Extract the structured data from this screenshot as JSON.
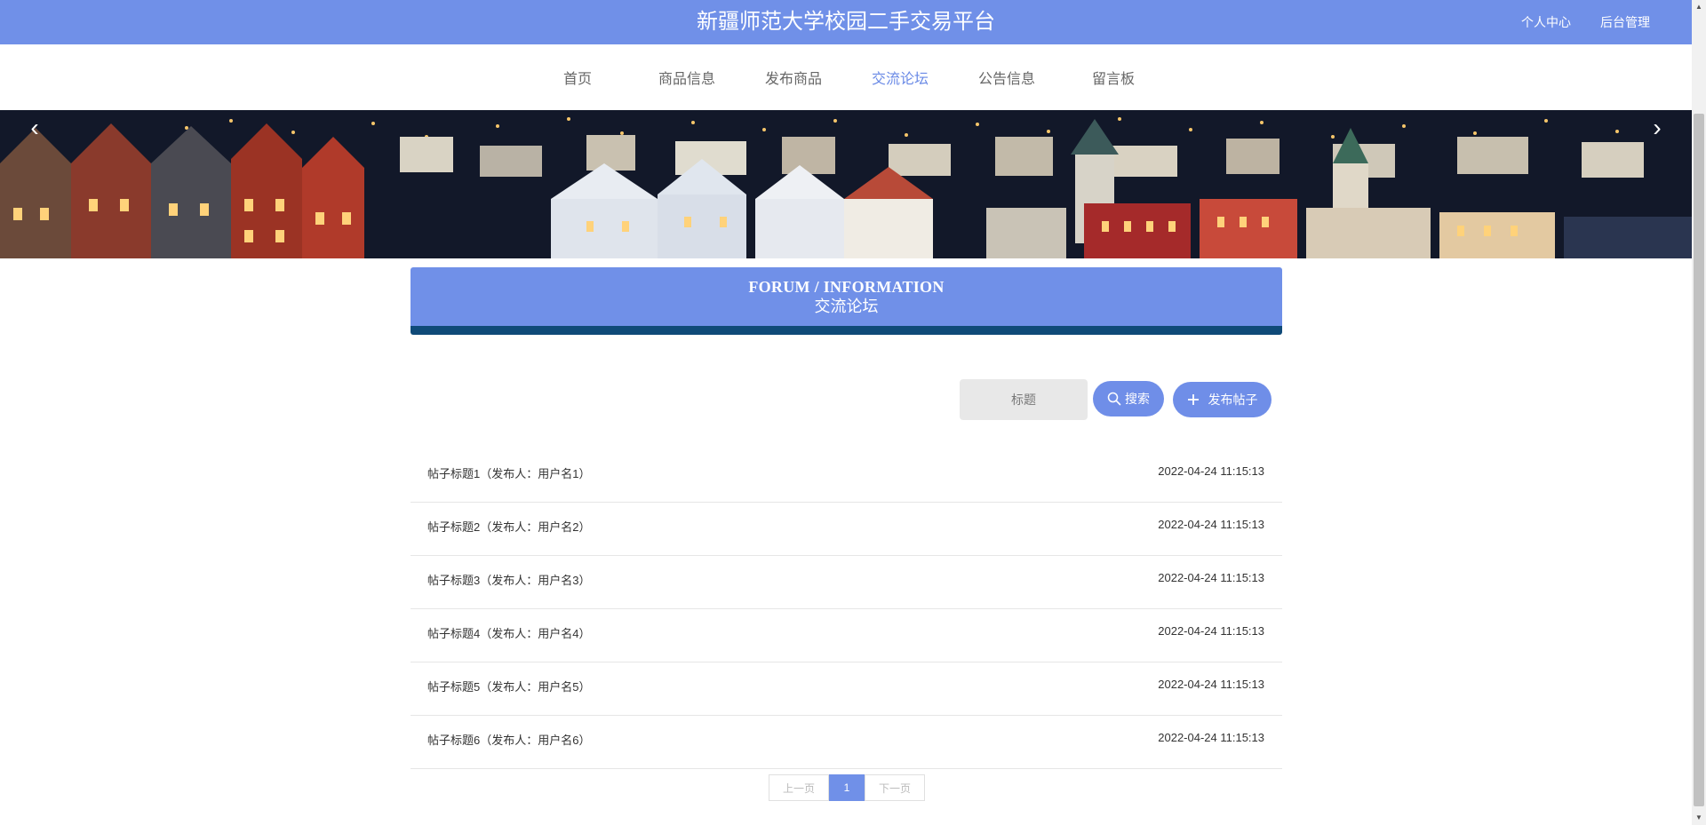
{
  "header": {
    "site_title": "新疆师范大学校园二手交易平台",
    "links": [
      "个人中心",
      "后台管理"
    ]
  },
  "nav": {
    "items": [
      "首页",
      "商品信息",
      "发布商品",
      "交流论坛",
      "公告信息",
      "留言板"
    ],
    "active": "交流论坛"
  },
  "banner": {
    "prev_icon": "chevron-left-icon",
    "next_icon": "chevron-right-icon"
  },
  "section": {
    "title_en": "FORUM / INFORMATION",
    "title_cn": "交流论坛"
  },
  "search": {
    "placeholder": "标题",
    "search_label": "搜索",
    "publish_label": "发布帖子"
  },
  "posts": [
    {
      "title": "帖子标题1（发布人：用户名1）",
      "time": "2022-04-24 11:15:13"
    },
    {
      "title": "帖子标题2（发布人：用户名2）",
      "time": "2022-04-24 11:15:13"
    },
    {
      "title": "帖子标题3（发布人：用户名3）",
      "time": "2022-04-24 11:15:13"
    },
    {
      "title": "帖子标题4（发布人：用户名4）",
      "time": "2022-04-24 11:15:13"
    },
    {
      "title": "帖子标题5（发布人：用户名5）",
      "time": "2022-04-24 11:15:13"
    },
    {
      "title": "帖子标题6（发布人：用户名6）",
      "time": "2022-04-24 11:15:13"
    }
  ],
  "pagination": {
    "prev": "上一页",
    "current": "1",
    "next": "下一页"
  },
  "colors": {
    "primary": "#7090e8",
    "section_bar": "#0f4a78",
    "nav_active": "#6a8ae6"
  }
}
